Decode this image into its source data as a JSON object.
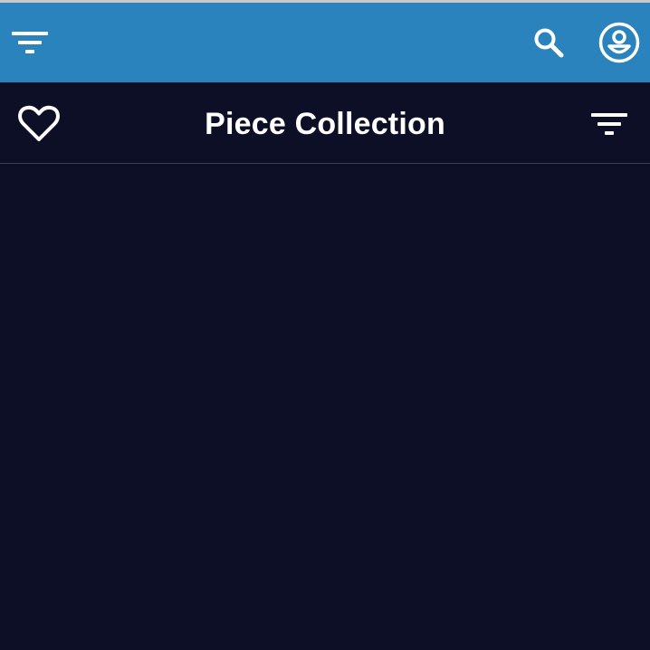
{
  "app_bar": {
    "filter_icon": "filter-icon",
    "search_icon": "search-icon",
    "account_icon": "account-circle-icon",
    "background_color": "#2a83bd"
  },
  "sub_header": {
    "favorite_icon": "heart-outline-icon",
    "title": "Piece Collection",
    "sort_icon": "filter-icon"
  },
  "theme": {
    "background_color": "#0c0f26",
    "text_color": "#ffffff"
  }
}
